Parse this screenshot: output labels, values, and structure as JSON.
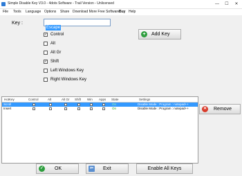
{
  "window": {
    "title": "Simple Disable Key V3.0 - 4dots Software - Trail Version - Unlicensed",
    "controls": {
      "minimize": "—",
      "maximize": "☐",
      "close": "✕"
    }
  },
  "menu": [
    "File",
    "Tools",
    "Language",
    "Options",
    "Share",
    "Download More Free Software",
    "Buy",
    "Help"
  ],
  "key": {
    "label": "Key :",
    "value": "Escape"
  },
  "modifiers": [
    {
      "label": "Control",
      "checked": true
    },
    {
      "label": "Alt",
      "checked": false
    },
    {
      "label": "Alt Gr",
      "checked": false
    },
    {
      "label": "Shift",
      "checked": true
    },
    {
      "label": "Left Windows Key",
      "checked": false
    },
    {
      "label": "Right Windows Key",
      "checked": false
    }
  ],
  "buttons": {
    "add_key": "Add Key",
    "remove": "Remove",
    "ok": "OK",
    "exit": "Exit",
    "enable_all": "Enable All Keys"
  },
  "table": {
    "columns": [
      "HotKey",
      "Control",
      "Alt",
      "Alt Gr",
      "Shift",
      "Win",
      "Apps",
      "State",
      "Settings"
    ],
    "rows": [
      {
        "hotkey": "Scroll",
        "state": "On",
        "settings": "Disable Mode : Program : notepad++",
        "selected": true
      },
      {
        "hotkey": "Insert",
        "state": "On",
        "settings": "Disable Mode : Program : notepad++",
        "selected": false
      }
    ]
  },
  "colors": {
    "selection": "#3399ff",
    "add": "#2e9e3e",
    "remove": "#d93b2b",
    "ok": "#2e9e3e"
  }
}
